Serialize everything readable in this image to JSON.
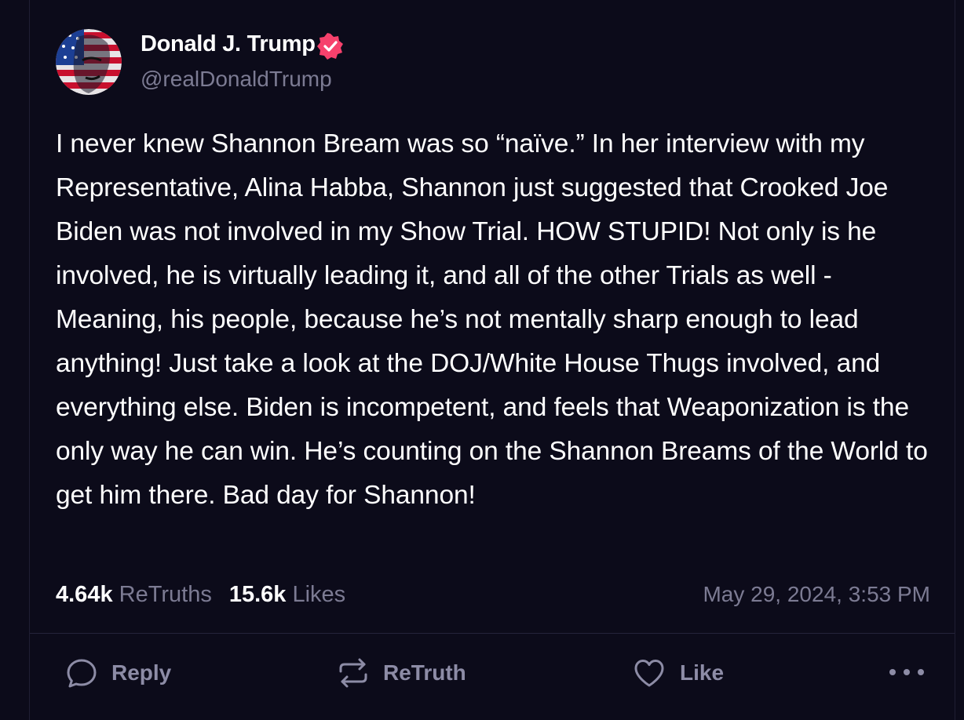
{
  "post": {
    "author": {
      "display_name": "Donald J. Trump",
      "handle": "@realDonaldTrump",
      "verified": true,
      "verified_color": "#f6416c"
    },
    "body": "I never knew Shannon Bream was so “naïve.” In her interview with my Representative, Alina Habba, Shannon just suggested that Crooked Joe Biden was not involved in my Show Trial. HOW STUPID! Not only is he involved, he is virtually leading it, and all of the other Trials as well - Meaning, his people, because he’s not mentally sharp enough to lead anything! Just take a look at the DOJ/White House Thugs involved, and everything else. Biden is incompetent, and feels that Weaponization is the only way he can win. He’s counting on the Shannon Breams of the World to get him there. Bad day for Shannon!",
    "stats": {
      "retruths_count": "4.64k",
      "retruths_label": "ReTruths",
      "likes_count": "15.6k",
      "likes_label": "Likes"
    },
    "timestamp": "May 29, 2024, 3:53 PM"
  },
  "actions": {
    "reply": {
      "label": "Reply",
      "icon": "reply-bubble-icon"
    },
    "retruth": {
      "label": "ReTruth",
      "icon": "retruth-arrows-icon"
    },
    "like": {
      "label": "Like",
      "icon": "heart-icon"
    },
    "more": {
      "icon": "more-dots-icon"
    }
  },
  "colors": {
    "background": "#0c0b1a",
    "text_primary": "#ffffff",
    "text_secondary": "#7c7b93",
    "action_gray": "#8d8ca6"
  }
}
